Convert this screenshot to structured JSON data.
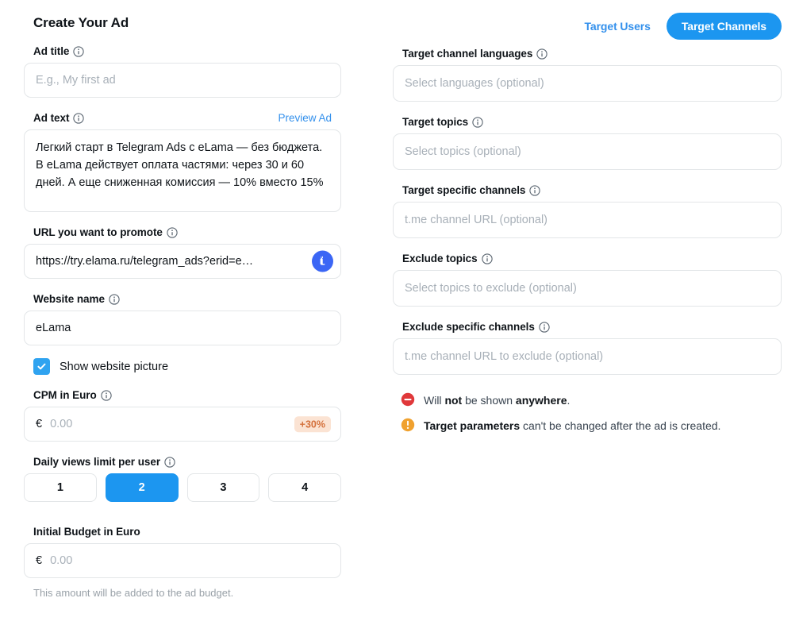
{
  "header": {
    "title": "Create Your Ad"
  },
  "tabs": {
    "target_users": "Target Users",
    "target_channels": "Target Channels",
    "active": "Target Channels"
  },
  "colors": {
    "accent_blue": "#1c96f0",
    "link_blue": "#3390ec",
    "badge_bg": "#fbe3d3",
    "badge_text": "#d4703b",
    "error_red": "#e0383a",
    "warning_orange": "#f0a12e",
    "border_gray": "#e3e6e8",
    "placeholder_gray": "#a8b0b8",
    "favicon_blue": "#3b66f5"
  },
  "left": {
    "ad_title": {
      "label": "Ad title",
      "info_icon": "info-circle-icon",
      "placeholder": "E.g., My first ad",
      "value": ""
    },
    "ad_text": {
      "label": "Ad text",
      "info_icon": "info-circle-icon",
      "preview_link": "Preview Ad",
      "value": "Легкий старт в Telegram Ads с eLama — без бюджета. В eLama действует оплата частями: через 30 и 60 дней. А еще сниженная комиссия — 10% вместо 15%"
    },
    "url": {
      "label": "URL you want to promote",
      "info_icon": "info-circle-icon",
      "value": "https://try.elama.ru/telegram_ads?erid=e…",
      "favicon_icon": "llama-favicon-icon"
    },
    "website_name": {
      "label": "Website name",
      "info_icon": "info-circle-icon",
      "value": "eLama"
    },
    "show_website_picture": {
      "label": "Show website picture",
      "checked": true,
      "icon": "checkmark-icon"
    },
    "cpm": {
      "label": "CPM in Euro",
      "info_icon": "info-circle-icon",
      "currency": "€",
      "placeholder": "0.00",
      "value": "",
      "badge": "+30%"
    },
    "daily_views_limit": {
      "label": "Daily views limit per user",
      "info_icon": "info-circle-icon",
      "options": [
        "1",
        "2",
        "3",
        "4"
      ],
      "selected": "2"
    },
    "initial_budget": {
      "label": "Initial Budget in Euro",
      "currency": "€",
      "placeholder": "0.00",
      "value": "",
      "helper": "This amount will be added to the ad budget."
    }
  },
  "right": {
    "target_channel_languages": {
      "label": "Target channel languages",
      "info_icon": "info-circle-icon",
      "placeholder": "Select languages (optional)",
      "value": ""
    },
    "target_topics": {
      "label": "Target topics",
      "info_icon": "info-circle-icon",
      "placeholder": "Select topics (optional)",
      "value": ""
    },
    "target_specific_channels": {
      "label": "Target specific channels",
      "info_icon": "info-circle-icon",
      "placeholder": "t.me channel URL (optional)",
      "value": ""
    },
    "exclude_topics": {
      "label": "Exclude topics",
      "info_icon": "info-circle-icon",
      "placeholder": "Select topics to exclude (optional)",
      "value": ""
    },
    "exclude_specific_channels": {
      "label": "Exclude specific channels",
      "info_icon": "info-circle-icon",
      "placeholder": "t.me channel URL to exclude (optional)",
      "value": ""
    },
    "notes": [
      {
        "icon": "minus-circle-icon",
        "icon_color": "#e0383a",
        "part1": "Will ",
        "bold1": "not",
        "part2": " be shown ",
        "bold2": "anywhere",
        "part3": "."
      },
      {
        "icon": "exclamation-circle-icon",
        "icon_color": "#f0a12e",
        "bold1": "Target parameters",
        "part2": " can't be changed after the ad is created.",
        "part1": "",
        "bold2": "",
        "part3": ""
      }
    ]
  }
}
